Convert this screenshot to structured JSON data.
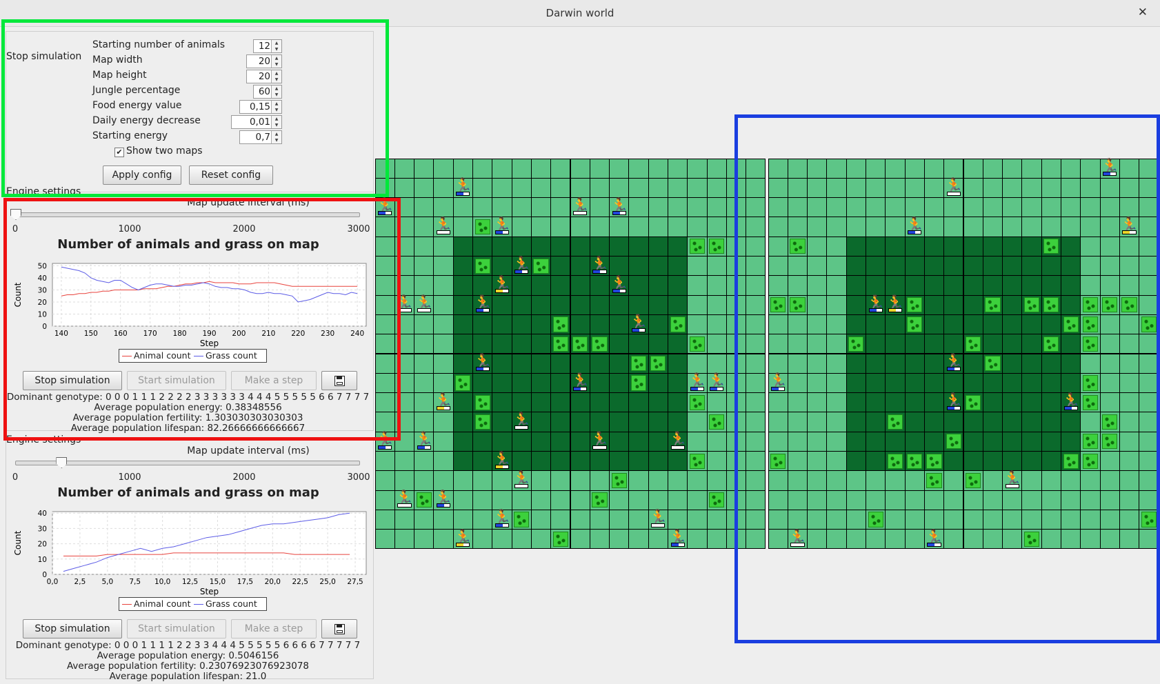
{
  "window": {
    "title": "Darwin world",
    "close_glyph": "✕"
  },
  "config": {
    "group_title": "Stop simulation",
    "fields": [
      {
        "label": "Starting number of animals",
        "value": "12"
      },
      {
        "label": "Map width",
        "value": "20"
      },
      {
        "label": "Map height",
        "value": "20"
      },
      {
        "label": "Jungle percentage",
        "value": "60"
      },
      {
        "label": "Food energy value",
        "value": "0,15"
      },
      {
        "label": "Daily energy decrease",
        "value": "0,01"
      },
      {
        "label": "Starting energy",
        "value": "0,7"
      }
    ],
    "show_two_maps_label": "Show two maps",
    "show_two_maps_checked": true,
    "check_glyph": "✔",
    "apply_label": "Apply config",
    "reset_label": "Reset config"
  },
  "engines": [
    {
      "group_title": "Engine settings",
      "slider_label": "Map update interval (ms)",
      "slider_ticks": [
        "0",
        "1000",
        "2000",
        "3000"
      ],
      "slider_value_ms": 0,
      "chart_title": "Number of animals and grass on map",
      "stop_label": "Stop simulation",
      "start_label": "Start simulation",
      "step_label": "Make a step",
      "save_icon": "floppy-disk-icon",
      "dominant_genotype": "Dominant genotype: 0 0 0 1 1 1 2 2 2 2 3 3 3 3 3 3 4 4 4 5 5 5 5 5 6 6 7 7 7 7",
      "avg_energy": "Average population energy: 0.38348556",
      "avg_fertility": "Average population fertility: 1.303030303030303",
      "avg_lifespan": "Average population lifespan: 82.26666666666667"
    },
    {
      "group_title": "Engine settings",
      "slider_label": "Map update interval (ms)",
      "slider_ticks": [
        "0",
        "1000",
        "2000",
        "3000"
      ],
      "slider_value_ms": 400,
      "chart_title": "Number of animals and grass on map",
      "stop_label": "Stop simulation",
      "start_label": "Start simulation",
      "step_label": "Make a step",
      "save_icon": "floppy-disk-icon",
      "dominant_genotype": "Dominant genotype: 0 0 0 1 1 1 1 2 2 3 3 4 4 4 5 5 5 5 5 6 6 6 6 7 7 7 7 7",
      "avg_energy": "Average population energy: 0.5046156",
      "avg_fertility": "Average population fertility: 0.23076923076923078",
      "avg_lifespan": "Average population lifespan: 21.0"
    }
  ],
  "chart_data": [
    {
      "type": "line",
      "title": "Number of animals and grass on map",
      "xlabel": "Step",
      "ylabel": "Count",
      "xlim": [
        137,
        243
      ],
      "ylim": [
        0,
        52
      ],
      "xticks": [
        "140",
        "150",
        "160",
        "170",
        "180",
        "190",
        "200",
        "210",
        "220",
        "230",
        "240"
      ],
      "yticks": [
        "0",
        "10",
        "20",
        "30",
        "40",
        "50"
      ],
      "grid": true,
      "legend": "bottom",
      "x": [
        140,
        142,
        144,
        146,
        148,
        150,
        152,
        154,
        156,
        158,
        160,
        162,
        164,
        166,
        168,
        170,
        172,
        174,
        176,
        178,
        180,
        182,
        184,
        186,
        188,
        190,
        192,
        194,
        196,
        198,
        200,
        202,
        204,
        206,
        208,
        210,
        212,
        214,
        216,
        218,
        220,
        222,
        224,
        226,
        228,
        230,
        232,
        234,
        236,
        238,
        240
      ],
      "series": [
        {
          "name": "Animal count",
          "color": "#e8423c",
          "values": [
            25,
            26,
            26,
            27,
            27,
            28,
            28,
            29,
            29,
            30,
            30,
            30,
            30,
            30,
            31,
            31,
            31,
            32,
            33,
            33,
            34,
            35,
            35,
            36,
            36,
            37,
            36,
            36,
            36,
            36,
            35,
            35,
            35,
            36,
            36,
            36,
            36,
            35,
            34,
            33,
            33,
            33,
            33,
            33,
            33,
            33,
            33,
            33,
            33,
            33,
            33
          ]
        },
        {
          "name": "Grass count",
          "color": "#5c5ce6",
          "values": [
            49,
            48,
            47,
            46,
            44,
            40,
            38,
            37,
            36,
            38,
            38,
            35,
            32,
            30,
            32,
            34,
            35,
            35,
            34,
            33,
            33,
            34,
            34,
            35,
            36,
            35,
            33,
            32,
            32,
            31,
            31,
            30,
            28,
            27,
            27,
            28,
            27,
            27,
            26,
            25,
            20,
            21,
            22,
            24,
            26,
            28,
            27,
            27,
            26,
            28,
            27
          ]
        }
      ]
    },
    {
      "type": "line",
      "title": "Number of animals and grass on map",
      "xlabel": "Step",
      "ylabel": "Count",
      "xlim": [
        0,
        28.5
      ],
      "ylim": [
        0,
        41
      ],
      "xticks": [
        "0,0",
        "2,5",
        "5,0",
        "7,5",
        "10,0",
        "12,5",
        "15,0",
        "17,5",
        "20,0",
        "22,5",
        "25,0",
        "27,5"
      ],
      "yticks": [
        "0",
        "10",
        "20",
        "30",
        "40"
      ],
      "grid": true,
      "legend": "bottom",
      "x": [
        1,
        2,
        3,
        4,
        5,
        6,
        7,
        8,
        9,
        10,
        11,
        12,
        13,
        14,
        15,
        16,
        17,
        18,
        19,
        20,
        21,
        22,
        23,
        24,
        25,
        26,
        27
      ],
      "series": [
        {
          "name": "Animal count",
          "color": "#e8423c",
          "values": [
            12,
            12,
            12,
            12,
            13,
            13,
            13,
            13,
            13,
            13,
            14,
            14,
            14,
            14,
            14,
            14,
            14,
            14,
            14,
            14,
            14,
            13,
            13,
            13,
            13,
            13,
            13
          ]
        },
        {
          "name": "Grass count",
          "color": "#5c5ce6",
          "values": [
            2,
            4,
            6,
            8,
            11,
            13,
            15,
            17,
            15,
            17,
            18,
            20,
            22,
            24,
            25,
            26,
            28,
            30,
            32,
            33,
            33,
            34,
            35,
            36,
            37,
            39,
            40
          ]
        }
      ]
    }
  ],
  "maps": {
    "size": 20,
    "jungle": {
      "x0": 4,
      "y0": 4,
      "x1": 16,
      "y1": 16
    },
    "left": {
      "grass": [
        [
          5,
          3
        ],
        [
          16,
          4
        ],
        [
          17,
          4
        ],
        [
          5,
          5
        ],
        [
          8,
          5
        ],
        [
          9,
          8
        ],
        [
          15,
          8
        ],
        [
          16,
          9
        ],
        [
          9,
          9
        ],
        [
          10,
          9
        ],
        [
          11,
          9
        ],
        [
          16,
          9
        ],
        [
          13,
          10
        ],
        [
          14,
          10
        ],
        [
          4,
          11
        ],
        [
          13,
          11
        ],
        [
          5,
          12
        ],
        [
          16,
          12
        ],
        [
          17,
          13
        ],
        [
          5,
          13
        ],
        [
          16,
          15
        ],
        [
          12,
          16
        ],
        [
          2,
          17
        ],
        [
          11,
          17
        ],
        [
          17,
          17
        ],
        [
          7,
          18
        ],
        [
          9,
          19
        ]
      ],
      "animals": [
        [
          0,
          2,
          "#2244dd"
        ],
        [
          4,
          1,
          "#2244dd"
        ],
        [
          10,
          2,
          "#ffffff"
        ],
        [
          12,
          2,
          "#2244dd"
        ],
        [
          3,
          3,
          "#ffffff"
        ],
        [
          6,
          3,
          "#2244dd"
        ],
        [
          7,
          5,
          "#2244dd"
        ],
        [
          11,
          5,
          "#2244dd"
        ],
        [
          6,
          6,
          "#ecd52a"
        ],
        [
          12,
          6,
          "#2244dd"
        ],
        [
          1,
          7,
          "#ffffff"
        ],
        [
          2,
          7,
          "#ffffff"
        ],
        [
          5,
          7,
          "#2244dd"
        ],
        [
          13,
          8,
          "#2244dd"
        ],
        [
          5,
          10,
          "#2244dd"
        ],
        [
          10,
          11,
          "#2244dd"
        ],
        [
          16,
          11,
          "#2244dd"
        ],
        [
          17,
          11,
          "#2244dd"
        ],
        [
          3,
          12,
          "#ecd52a"
        ],
        [
          7,
          13,
          "#ffffff"
        ],
        [
          0,
          14,
          "#2244dd"
        ],
        [
          2,
          14,
          "#2244dd"
        ],
        [
          11,
          14,
          "#ffffff"
        ],
        [
          15,
          14,
          "#ffffff"
        ],
        [
          6,
          15,
          "#ecd52a"
        ],
        [
          7,
          16,
          "#ffffff"
        ],
        [
          1,
          17,
          "#ffffff"
        ],
        [
          3,
          17,
          "#2244dd"
        ],
        [
          6,
          18,
          "#2244dd"
        ],
        [
          14,
          18,
          "#ffffff"
        ],
        [
          4,
          19,
          "#ecd52a"
        ],
        [
          15,
          19,
          "#2244dd"
        ]
      ]
    },
    "right": {
      "grass": [
        [
          1,
          4
        ],
        [
          14,
          4
        ],
        [
          0,
          7
        ],
        [
          1,
          7
        ],
        [
          7,
          7
        ],
        [
          11,
          7
        ],
        [
          13,
          7
        ],
        [
          14,
          7
        ],
        [
          16,
          7
        ],
        [
          17,
          7
        ],
        [
          18,
          7
        ],
        [
          7,
          8
        ],
        [
          15,
          8
        ],
        [
          16,
          8
        ],
        [
          19,
          8
        ],
        [
          4,
          9
        ],
        [
          10,
          9
        ],
        [
          14,
          9
        ],
        [
          16,
          9
        ],
        [
          11,
          10
        ],
        [
          16,
          11
        ],
        [
          10,
          12
        ],
        [
          16,
          12
        ],
        [
          6,
          13
        ],
        [
          17,
          13
        ],
        [
          9,
          14
        ],
        [
          16,
          14
        ],
        [
          17,
          14
        ],
        [
          0,
          15
        ],
        [
          6,
          15
        ],
        [
          7,
          15
        ],
        [
          8,
          15
        ],
        [
          15,
          15
        ],
        [
          16,
          15
        ],
        [
          8,
          16
        ],
        [
          10,
          16
        ],
        [
          5,
          18
        ],
        [
          19,
          18
        ],
        [
          13,
          19
        ]
      ],
      "animals": [
        [
          17,
          0,
          "#2244dd"
        ],
        [
          9,
          1,
          "#ffffff"
        ],
        [
          7,
          3,
          "#2244dd"
        ],
        [
          18,
          3,
          "#ecd52a"
        ],
        [
          5,
          7,
          "#2244dd"
        ],
        [
          6,
          7,
          "#ecd52a"
        ],
        [
          9,
          10,
          "#2244dd"
        ],
        [
          0,
          11,
          "#2244dd"
        ],
        [
          9,
          12,
          "#2244dd"
        ],
        [
          15,
          12,
          "#2244dd"
        ],
        [
          12,
          16,
          "#ffffff"
        ],
        [
          1,
          19,
          "#ffffff"
        ],
        [
          8,
          19,
          "#2244dd"
        ]
      ]
    }
  },
  "colors": {
    "steppe": "#5dc587",
    "jungle": "#0b6a2c",
    "grid_line": "#000000",
    "animal_glyph": "🏃"
  }
}
